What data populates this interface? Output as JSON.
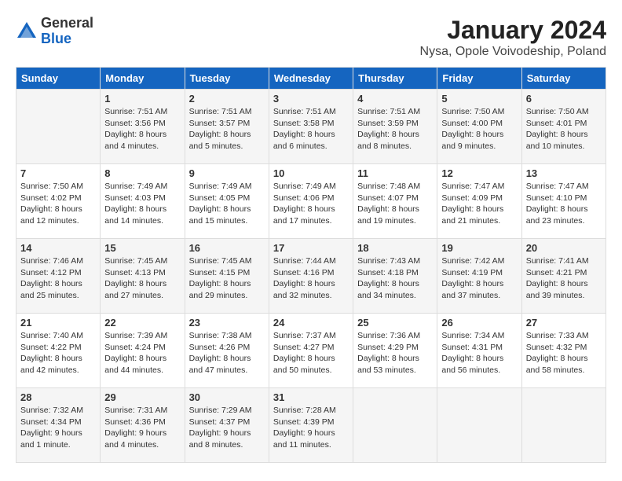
{
  "logo": {
    "general": "General",
    "blue": "Blue"
  },
  "title": "January 2024",
  "subtitle": "Nysa, Opole Voivodeship, Poland",
  "days_of_week": [
    "Sunday",
    "Monday",
    "Tuesday",
    "Wednesday",
    "Thursday",
    "Friday",
    "Saturday"
  ],
  "weeks": [
    [
      {
        "day": "",
        "info": ""
      },
      {
        "day": "1",
        "info": "Sunrise: 7:51 AM\nSunset: 3:56 PM\nDaylight: 8 hours\nand 4 minutes."
      },
      {
        "day": "2",
        "info": "Sunrise: 7:51 AM\nSunset: 3:57 PM\nDaylight: 8 hours\nand 5 minutes."
      },
      {
        "day": "3",
        "info": "Sunrise: 7:51 AM\nSunset: 3:58 PM\nDaylight: 8 hours\nand 6 minutes."
      },
      {
        "day": "4",
        "info": "Sunrise: 7:51 AM\nSunset: 3:59 PM\nDaylight: 8 hours\nand 8 minutes."
      },
      {
        "day": "5",
        "info": "Sunrise: 7:50 AM\nSunset: 4:00 PM\nDaylight: 8 hours\nand 9 minutes."
      },
      {
        "day": "6",
        "info": "Sunrise: 7:50 AM\nSunset: 4:01 PM\nDaylight: 8 hours\nand 10 minutes."
      }
    ],
    [
      {
        "day": "7",
        "info": "Sunrise: 7:50 AM\nSunset: 4:02 PM\nDaylight: 8 hours\nand 12 minutes."
      },
      {
        "day": "8",
        "info": "Sunrise: 7:49 AM\nSunset: 4:03 PM\nDaylight: 8 hours\nand 14 minutes."
      },
      {
        "day": "9",
        "info": "Sunrise: 7:49 AM\nSunset: 4:05 PM\nDaylight: 8 hours\nand 15 minutes."
      },
      {
        "day": "10",
        "info": "Sunrise: 7:49 AM\nSunset: 4:06 PM\nDaylight: 8 hours\nand 17 minutes."
      },
      {
        "day": "11",
        "info": "Sunrise: 7:48 AM\nSunset: 4:07 PM\nDaylight: 8 hours\nand 19 minutes."
      },
      {
        "day": "12",
        "info": "Sunrise: 7:47 AM\nSunset: 4:09 PM\nDaylight: 8 hours\nand 21 minutes."
      },
      {
        "day": "13",
        "info": "Sunrise: 7:47 AM\nSunset: 4:10 PM\nDaylight: 8 hours\nand 23 minutes."
      }
    ],
    [
      {
        "day": "14",
        "info": "Sunrise: 7:46 AM\nSunset: 4:12 PM\nDaylight: 8 hours\nand 25 minutes."
      },
      {
        "day": "15",
        "info": "Sunrise: 7:45 AM\nSunset: 4:13 PM\nDaylight: 8 hours\nand 27 minutes."
      },
      {
        "day": "16",
        "info": "Sunrise: 7:45 AM\nSunset: 4:15 PM\nDaylight: 8 hours\nand 29 minutes."
      },
      {
        "day": "17",
        "info": "Sunrise: 7:44 AM\nSunset: 4:16 PM\nDaylight: 8 hours\nand 32 minutes."
      },
      {
        "day": "18",
        "info": "Sunrise: 7:43 AM\nSunset: 4:18 PM\nDaylight: 8 hours\nand 34 minutes."
      },
      {
        "day": "19",
        "info": "Sunrise: 7:42 AM\nSunset: 4:19 PM\nDaylight: 8 hours\nand 37 minutes."
      },
      {
        "day": "20",
        "info": "Sunrise: 7:41 AM\nSunset: 4:21 PM\nDaylight: 8 hours\nand 39 minutes."
      }
    ],
    [
      {
        "day": "21",
        "info": "Sunrise: 7:40 AM\nSunset: 4:22 PM\nDaylight: 8 hours\nand 42 minutes."
      },
      {
        "day": "22",
        "info": "Sunrise: 7:39 AM\nSunset: 4:24 PM\nDaylight: 8 hours\nand 44 minutes."
      },
      {
        "day": "23",
        "info": "Sunrise: 7:38 AM\nSunset: 4:26 PM\nDaylight: 8 hours\nand 47 minutes."
      },
      {
        "day": "24",
        "info": "Sunrise: 7:37 AM\nSunset: 4:27 PM\nDaylight: 8 hours\nand 50 minutes."
      },
      {
        "day": "25",
        "info": "Sunrise: 7:36 AM\nSunset: 4:29 PM\nDaylight: 8 hours\nand 53 minutes."
      },
      {
        "day": "26",
        "info": "Sunrise: 7:34 AM\nSunset: 4:31 PM\nDaylight: 8 hours\nand 56 minutes."
      },
      {
        "day": "27",
        "info": "Sunrise: 7:33 AM\nSunset: 4:32 PM\nDaylight: 8 hours\nand 58 minutes."
      }
    ],
    [
      {
        "day": "28",
        "info": "Sunrise: 7:32 AM\nSunset: 4:34 PM\nDaylight: 9 hours\nand 1 minute."
      },
      {
        "day": "29",
        "info": "Sunrise: 7:31 AM\nSunset: 4:36 PM\nDaylight: 9 hours\nand 4 minutes."
      },
      {
        "day": "30",
        "info": "Sunrise: 7:29 AM\nSunset: 4:37 PM\nDaylight: 9 hours\nand 8 minutes."
      },
      {
        "day": "31",
        "info": "Sunrise: 7:28 AM\nSunset: 4:39 PM\nDaylight: 9 hours\nand 11 minutes."
      },
      {
        "day": "",
        "info": ""
      },
      {
        "day": "",
        "info": ""
      },
      {
        "day": "",
        "info": ""
      }
    ]
  ]
}
